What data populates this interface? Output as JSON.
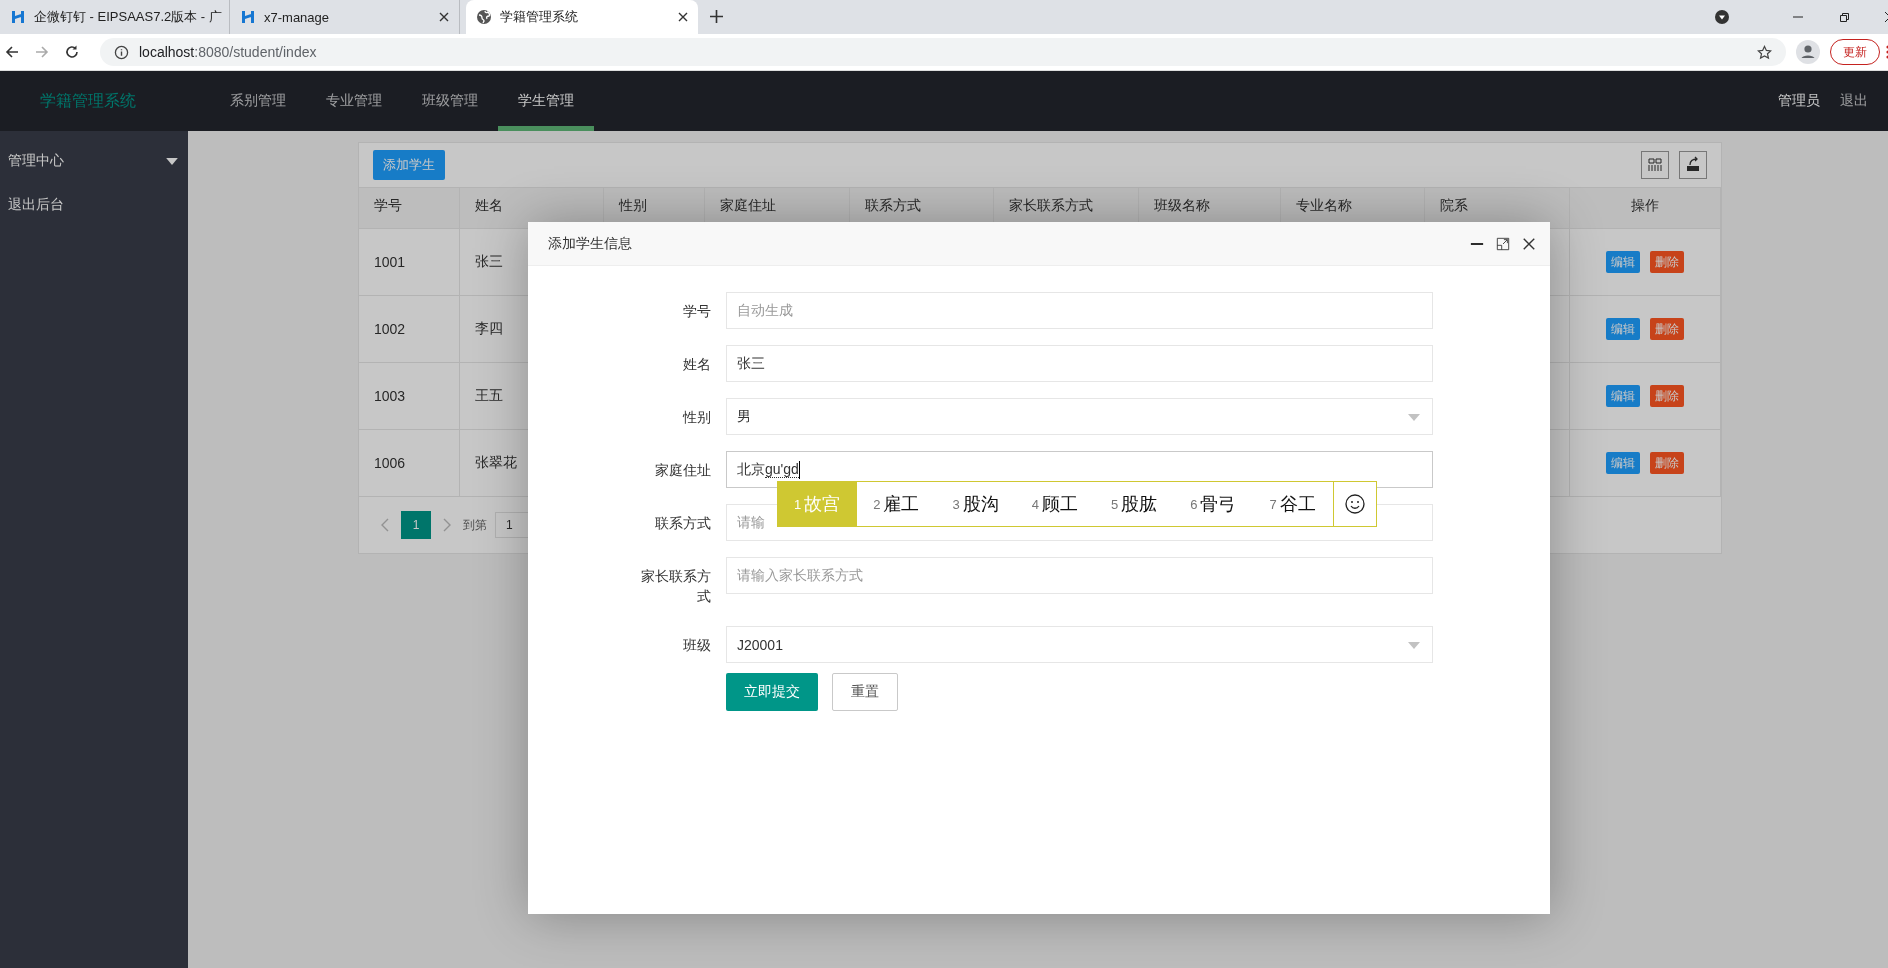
{
  "browser": {
    "tabs": [
      {
        "title": "企微钉钉 - EIPSAAS7.2版本 - 广",
        "selected": false
      },
      {
        "title": "x7-manage",
        "selected": false
      },
      {
        "title": "学籍管理系统",
        "selected": true
      }
    ],
    "url_host": "localhost",
    "url_rest": ":8080/student/index",
    "update_button": "更新"
  },
  "app": {
    "brand": "学籍管理系统",
    "nav": [
      {
        "label": "系别管理",
        "selected": false
      },
      {
        "label": "专业管理",
        "selected": false
      },
      {
        "label": "班级管理",
        "selected": false
      },
      {
        "label": "学生管理",
        "selected": true
      }
    ],
    "user": "管理员",
    "logout": "退出",
    "sidebar": [
      {
        "label": "管理中心",
        "kind": "group"
      },
      {
        "label": "退出后台",
        "kind": "link"
      }
    ],
    "add_button": "添加学生",
    "columns": [
      "学号",
      "姓名",
      "性别",
      "家庭住址",
      "联系方式",
      "家长联系方式",
      "班级名称",
      "专业名称",
      "院系",
      "操作"
    ],
    "rows": [
      {
        "cells": [
          "1001",
          "张三"
        ],
        "actions": [
          "编辑",
          "删除"
        ]
      },
      {
        "cells": [
          "1002",
          "李四"
        ],
        "actions": [
          "编辑",
          "删除"
        ]
      },
      {
        "cells": [
          "1003",
          "王五"
        ],
        "actions": [
          "编辑",
          "删除"
        ]
      },
      {
        "cells": [
          "1006",
          "张翠花"
        ],
        "actions": [
          "编辑",
          "删除"
        ]
      }
    ],
    "pager": {
      "pages": [
        {
          "label": "1",
          "selected": true
        }
      ],
      "goto_label": "到第",
      "goto_value": "1"
    }
  },
  "modal": {
    "title": "添加学生信息",
    "fields": [
      {
        "label": "学号",
        "kind": "text",
        "placeholder": "自动生成",
        "focused": false
      },
      {
        "label": "姓名",
        "kind": "text",
        "value": "张三",
        "focused": false
      },
      {
        "label": "性别",
        "kind": "select",
        "value": "男",
        "focused": false
      },
      {
        "label": "家庭住址",
        "kind": "text",
        "value": "北京",
        "composition": "gu'gd",
        "focused": true
      },
      {
        "label": "联系方式",
        "kind": "text",
        "placeholder": "请输",
        "focused": false
      },
      {
        "label": "家长联系方式",
        "kind": "text",
        "placeholder": "请输入家长联系方式",
        "focused": false
      },
      {
        "label": "班级",
        "kind": "select",
        "value": "J20001",
        "focused": false
      }
    ],
    "submit": "立即提交",
    "reset": "重置"
  },
  "ime": {
    "candidates": [
      {
        "index": "1",
        "text": "故宫",
        "selected": true
      },
      {
        "index": "2",
        "text": "雇工",
        "selected": false
      },
      {
        "index": "3",
        "text": "股沟",
        "selected": false
      },
      {
        "index": "4",
        "text": "顾工",
        "selected": false
      },
      {
        "index": "5",
        "text": "股肱",
        "selected": false
      },
      {
        "index": "6",
        "text": "骨弓",
        "selected": false
      },
      {
        "index": "7",
        "text": "谷工",
        "selected": false
      }
    ]
  }
}
